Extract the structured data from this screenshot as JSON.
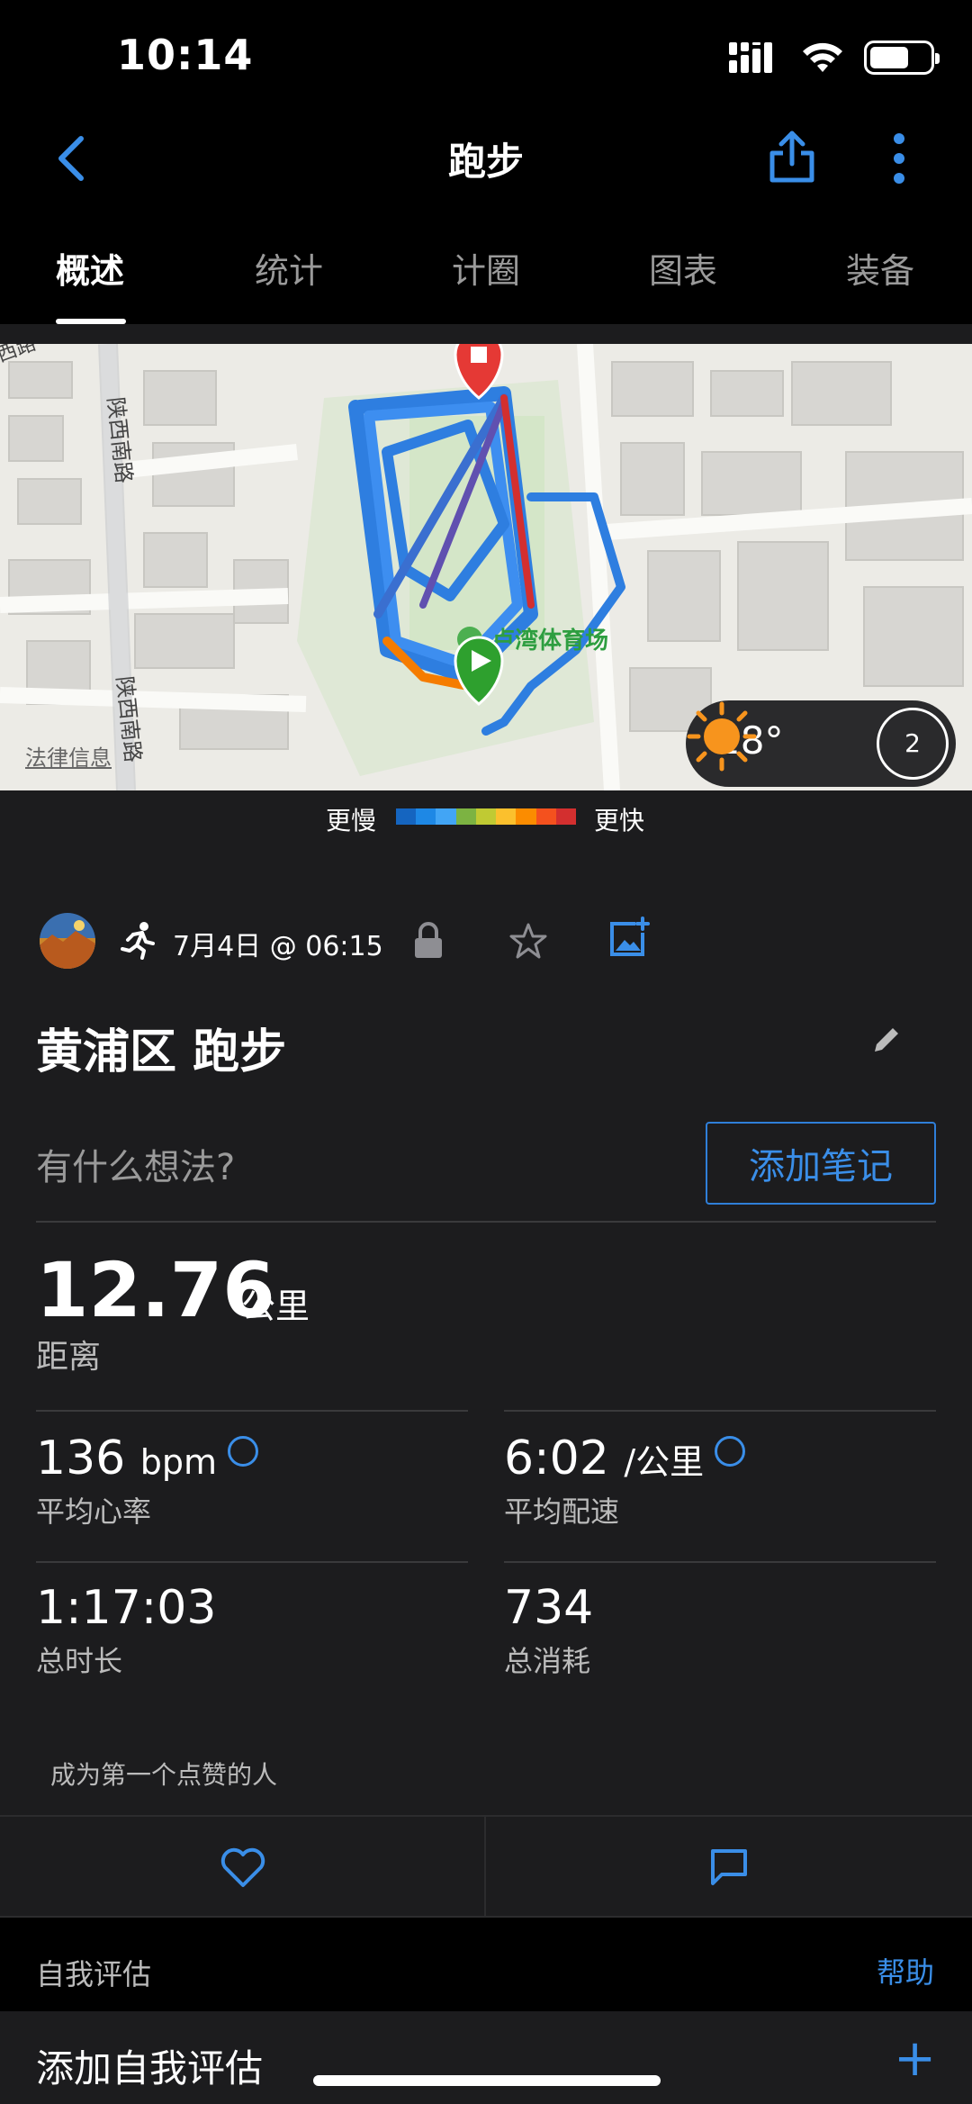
{
  "status_bar": {
    "time": "10:14"
  },
  "nav": {
    "title": "跑步"
  },
  "tabs": [
    {
      "label": "概述",
      "active": true
    },
    {
      "label": "统计",
      "active": false
    },
    {
      "label": "计圈",
      "active": false
    },
    {
      "label": "图表",
      "active": false
    },
    {
      "label": "装备",
      "active": false
    }
  ],
  "map": {
    "road_labels": [
      "陕西南路",
      "陕西南路",
      "西路"
    ],
    "poi_label": "卢湾体育场",
    "legal_link": "法律信息",
    "weather": {
      "temp": "28°",
      "wind": "2"
    }
  },
  "pace_legend": {
    "slow_label": "更慢",
    "fast_label": "更快",
    "colors": [
      "#1565c0",
      "#1e88e5",
      "#42a5f5",
      "#7cb342",
      "#c0ca33",
      "#fbc02d",
      "#fb8c00",
      "#f4511e",
      "#d32f2f"
    ]
  },
  "activity": {
    "date": "7月4日 @ 06:15",
    "title": "黄浦区 跑步",
    "notes_prompt": "有什么想法?",
    "add_note_label": "添加笔记"
  },
  "stats": {
    "distance": {
      "value": "12.76",
      "unit": "公里",
      "label": "距离"
    },
    "avg_hr": {
      "value": "136",
      "unit": "bpm",
      "label": "平均心率"
    },
    "avg_pace": {
      "value": "6:02",
      "unit": "/公里",
      "label": "平均配速"
    },
    "total_time": {
      "value": "1:17:03",
      "label": "总时长"
    },
    "calories": {
      "value": "734",
      "label": "总消耗"
    }
  },
  "social": {
    "likes_text": "成为第一个点赞的人"
  },
  "self_eval": {
    "title": "自我评估",
    "help": "帮助",
    "add_label": "添加自我评估",
    "add_icon": "+"
  },
  "colors": {
    "accent": "#3a8ee8",
    "background": "#1c1c1e"
  }
}
